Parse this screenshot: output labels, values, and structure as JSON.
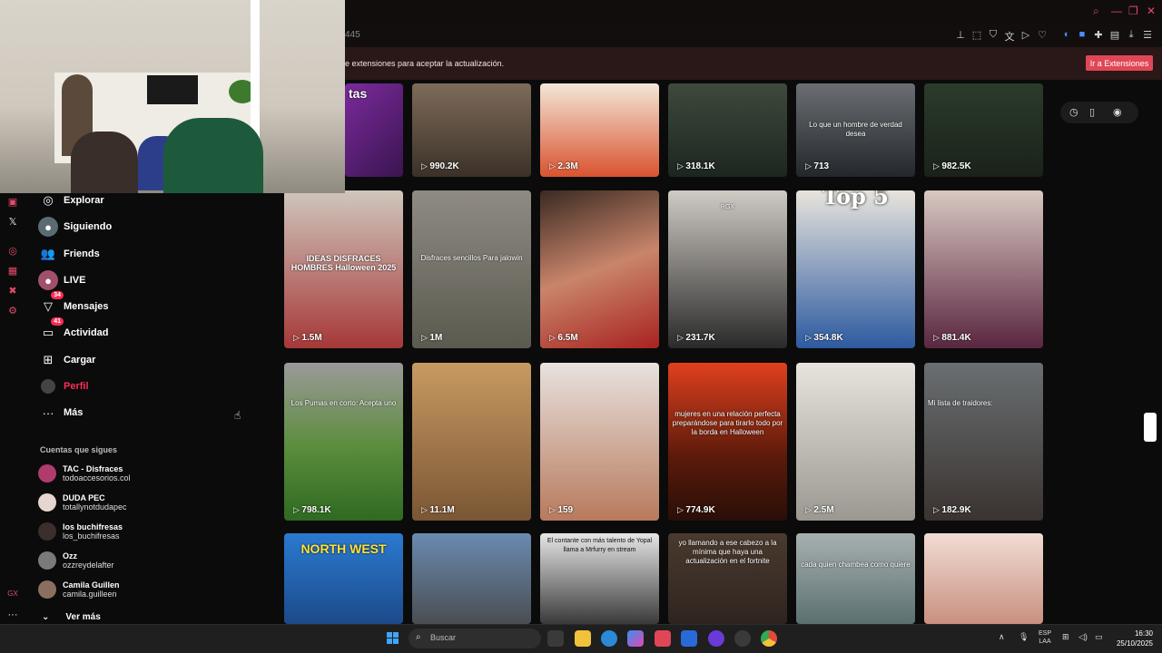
{
  "browser": {
    "url_fragment": "445",
    "notice_text": "e extensiones para aceptar la actualización.",
    "notice_button": "Ir a Extensiones"
  },
  "sidebar": {
    "items": [
      {
        "label": "Explorar",
        "icon": "compass-icon"
      },
      {
        "label": "Siguiendo",
        "icon": "following-icon"
      },
      {
        "label": "Friends",
        "icon": "friends-icon"
      },
      {
        "label": "LIVE",
        "icon": "live-icon"
      },
      {
        "label": "Mensajes",
        "icon": "messages-icon",
        "badge": "34"
      },
      {
        "label": "Actividad",
        "icon": "activity-icon",
        "badge": "41"
      },
      {
        "label": "Cargar",
        "icon": "upload-icon"
      },
      {
        "label": "Perfil",
        "icon": "profile-icon"
      },
      {
        "label": "Más",
        "icon": "more-icon"
      }
    ],
    "following_title": "Cuentas que sigues",
    "following": [
      {
        "name": "TAC - Disfraces",
        "handle": "todoaccesorios.col"
      },
      {
        "name": "DUDA PEC",
        "handle": "totallynotdudapec"
      },
      {
        "name": "los buchifresas",
        "handle": "los_buchifresas"
      },
      {
        "name": "Ozz",
        "handle": "ozzreydelafter"
      },
      {
        "name": "Camila Guillen",
        "handle": "camila.guilleen"
      }
    ],
    "see_more": "Ver más"
  },
  "videos": {
    "row1": [
      {
        "count": "",
        "caption": "tas"
      },
      {
        "count": "990.2K",
        "caption": ""
      },
      {
        "count": "2.3M",
        "caption": ""
      },
      {
        "count": "318.1K",
        "caption": ""
      },
      {
        "count": "713",
        "caption": "Lo que un hombre de verdad desea"
      },
      {
        "count": "982.5K",
        "caption": ""
      }
    ],
    "row2": [
      {
        "count": "1.5M",
        "caption": "IDEAS DISFRACES HOMBRES Halloween 2025"
      },
      {
        "count": "1M",
        "caption": "Disfraces sencillos Para jalowin"
      },
      {
        "count": "6.5M",
        "caption": ""
      },
      {
        "count": "231.7K",
        "caption": "RGX"
      },
      {
        "count": "354.8K",
        "caption": "Top 5"
      },
      {
        "count": "881.4K",
        "caption": ""
      }
    ],
    "row3": [
      {
        "count": "798.1K",
        "caption": "Los Pumas en corto: Acepta uno"
      },
      {
        "count": "11.1M",
        "caption": ""
      },
      {
        "count": "159",
        "caption": ""
      },
      {
        "count": "774.9K",
        "caption": "mujeres en una relación perfecta preparándose para tirarlo todo por la borda en Halloween"
      },
      {
        "count": "2.5M",
        "caption": ""
      },
      {
        "count": "182.9K",
        "caption": "Mi lista de traidores:"
      }
    ],
    "row4": [
      {
        "count": "",
        "caption": "NORTH WEST"
      },
      {
        "count": "",
        "caption": ""
      },
      {
        "count": "",
        "caption": "El contante con más talento de Yopal llama a Mrfurry en stream"
      },
      {
        "count": "",
        "caption": "yo llamando a ese cabezo a la mínima que haya una actualización en el fortnite"
      },
      {
        "count": "",
        "caption": "cada quien chambea como quiere"
      },
      {
        "count": "",
        "caption": ""
      }
    ]
  },
  "taskbar": {
    "search_placeholder": "Buscar",
    "lang_top": "ESP",
    "lang_bottom": "LAA",
    "time": "16:30",
    "date": "25/10/2025"
  },
  "colors": {
    "accent": "#fe2c55",
    "notice_button": "#e04756",
    "background": "#0b0b0b"
  }
}
